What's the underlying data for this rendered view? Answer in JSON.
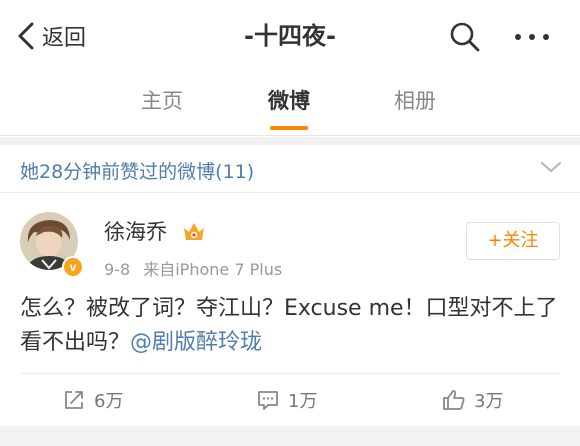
{
  "nav": {
    "back_label": "返回",
    "title": "-十四夜-"
  },
  "tabs": [
    {
      "label": "主页"
    },
    {
      "label": "微博"
    },
    {
      "label": "相册"
    }
  ],
  "active_tab": "微博",
  "liked_header": {
    "text": "她28分钟前赞过的微博(11)"
  },
  "post": {
    "username": "徐海乔",
    "time": "9-8",
    "source": "来自iPhone 7 Plus",
    "follow_label": "+关注",
    "badge_letter": "v",
    "text_before": "怎么？被改了词？夺江山？Excuse me！口型对不上了看不出吗？",
    "mention": "@剧版醉玲珑",
    "actions": {
      "repost_count": "6万",
      "comment_count": "1万",
      "like_count": "3万"
    }
  },
  "colors": {
    "accent": "#ff8200",
    "link": "#507daf",
    "text": "#333333",
    "muted": "#999999",
    "separator": "#f2f2f2"
  },
  "icons": {
    "back": "chevron-left-icon",
    "search": "search-icon",
    "more": "more-dots-icon",
    "expand": "chevron-down-icon",
    "repost": "repost-icon",
    "comment": "comment-icon",
    "like": "thumbs-up-icon",
    "vip": "vip-crown-icon"
  }
}
